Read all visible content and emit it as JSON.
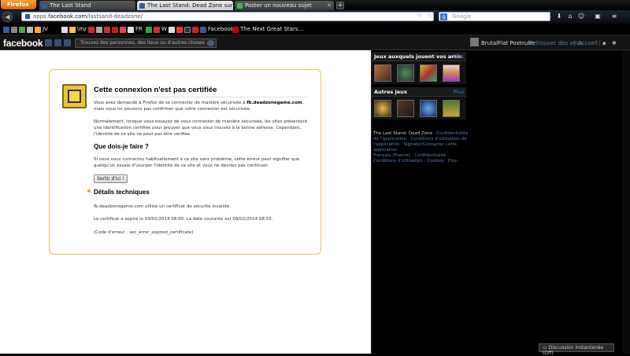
{
  "browser": {
    "app_button": "Firefox",
    "tabs": [
      {
        "label": "The Last Stand",
        "active": false
      },
      {
        "label": "The Last Stand: Dead Zone sur Faceb...",
        "active": true
      },
      {
        "label": "Poster un nouveau sujet",
        "active": false
      }
    ],
    "url_prefix": "apps.",
    "url_domain": "facebook.com",
    "url_path": "/lastsand-deadzone/",
    "search_placeholder": "Google",
    "bookmarks": [
      {
        "label": "JV",
        "color": "#e4e4e4"
      },
      {
        "label": "\\m/",
        "color": "#f6c343"
      },
      {
        "label": "FR",
        "color": "#d23"
      },
      {
        "label": "W",
        "color": "#fff"
      },
      {
        "label": "Facebook",
        "color": "#3b5998"
      },
      {
        "label": "The Next Great Stars...",
        "color": "#c00"
      }
    ]
  },
  "facebook": {
    "logo": "facebook",
    "search_placeholder": "Trouvez des personnes, des lieux ou d'autres choses",
    "user_name": "BrutalFlat Postnuke",
    "home_link": "Retrouver des amis",
    "accueil_link": "Accueil"
  },
  "error": {
    "title": "Cette connexion n'est pas certifiée",
    "para1_a": "Vous avez demandé à Firefox de se connecter de manière sécurisée à ",
    "para1_domain": "fb.deadzonegame.com",
    "para1_b": ", mais nous ne pouvons pas confirmer que votre connexion est sécurisée.",
    "para2": "Normalement, lorsque vous essayez de vous connecter de manière sécurisée, les sites présentent une identification certifiée pour prouver que vous vous trouvez à la bonne adresse. Cependant, l'identité de ce site ne peut pas être vérifiée.",
    "heading_what": "Que dois-je faire ?",
    "para3": "Si vous vous connectez habituellement à ce site sans problème, cette erreur peut signifier que quelqu'un essaie d'usurper l'identité de ce site et vous ne devriez pas continuer.",
    "button": "Sortir d'ici !",
    "heading_tech": "Détails techniques",
    "tech1": "fb.deadzonegame.com utilise un certificat de sécurité invalide.",
    "tech2": "Le certificat a expiré le 09/02/2014 08:00. La date courante est 09/02/2014 08:55.",
    "tech3": "(Code d'erreur : sec_error_expired_certificate)"
  },
  "sidebar": {
    "friends_games_title": "Jeux auxquels jouent vos amis",
    "other_games_title": "Autres jeux",
    "plus_label": "Plus",
    "footer_app": "The Last Stand: Dead Zone",
    "footer_links": "· Confidentialité de l'application · Conditions d'utilisation de l'application · Signaler/Contacter cette application",
    "footer_lang": "Français (France)",
    "footer_more": "· Confidentialité · Conditions d'utilisation · Cookies · Plus ·",
    "chat": "Discussion instantanée (Off)"
  },
  "colors": {
    "fb_blue": "#3b5998",
    "error_border": "#e4c36b",
    "link": "#5b7bb3"
  }
}
